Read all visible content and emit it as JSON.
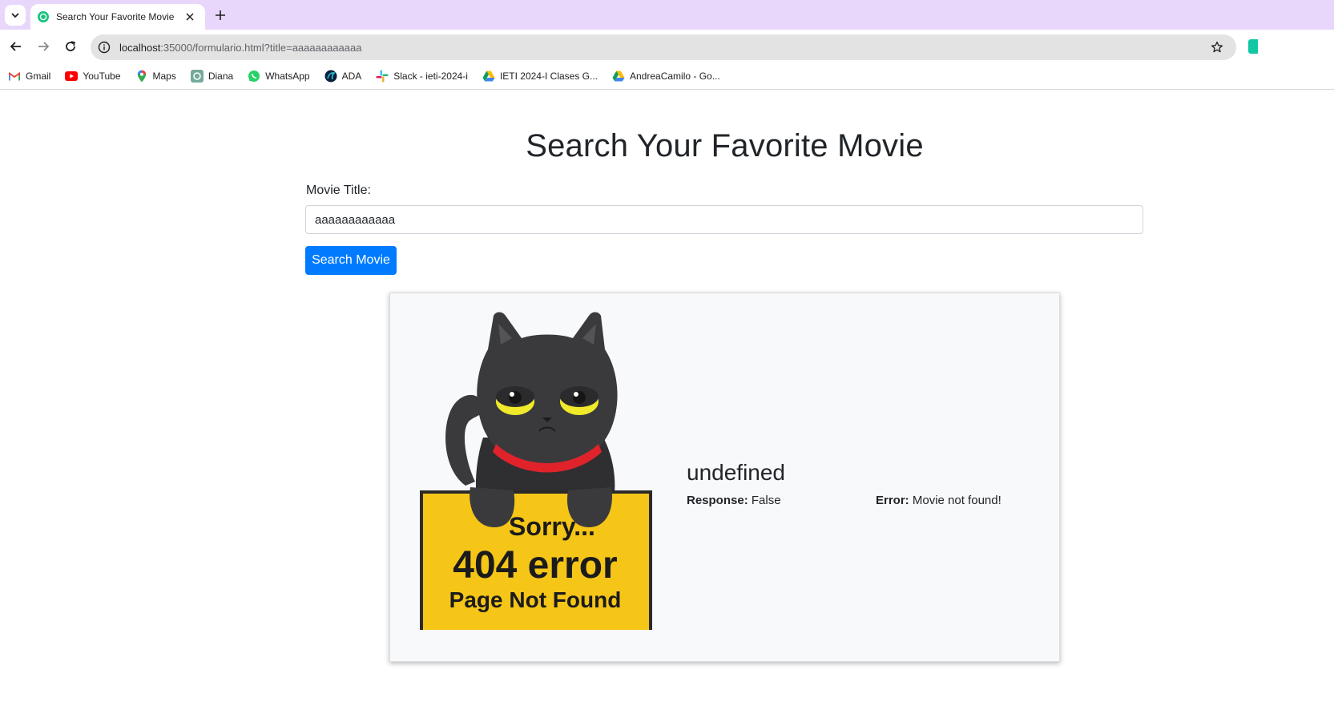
{
  "browser": {
    "tab_title": "Search Your Favorite Movie",
    "url_host": "localhost",
    "url_rest": ":35000/formulario.html?title=aaaaaaaaaaaa",
    "bookmarks": [
      {
        "label": "Gmail",
        "icon": "gmail-icon"
      },
      {
        "label": "YouTube",
        "icon": "youtube-icon"
      },
      {
        "label": "Maps",
        "icon": "maps-icon"
      },
      {
        "label": "Diana",
        "icon": "openai-icon"
      },
      {
        "label": "WhatsApp",
        "icon": "whatsapp-icon"
      },
      {
        "label": "ADA",
        "icon": "ada-icon"
      },
      {
        "label": "Slack - ieti-2024-i",
        "icon": "slack-icon"
      },
      {
        "label": "IETI 2024-I Clases G...",
        "icon": "google-drive-icon"
      },
      {
        "label": "AndreaCamilo - Go...",
        "icon": "google-drive-icon"
      }
    ]
  },
  "page": {
    "heading": "Search Your Favorite Movie",
    "form": {
      "label": "Movie Title:",
      "value": "aaaaaaaaaaaa",
      "button": "Search Movie"
    },
    "result": {
      "title": "undefined",
      "response_label": "Response:",
      "response_value": " False",
      "error_label": "Error:",
      "error_value": " Movie not found!",
      "poster": {
        "line1": "Sorry...",
        "line2": "404 error",
        "line3": "Page Not Found"
      }
    }
  },
  "colors": {
    "tabstrip": "#e9d7fb",
    "primary_button": "#007bff",
    "sign_yellow": "#f5c518",
    "cat_body": "#3a3a3c",
    "collar": "#e0232b"
  }
}
